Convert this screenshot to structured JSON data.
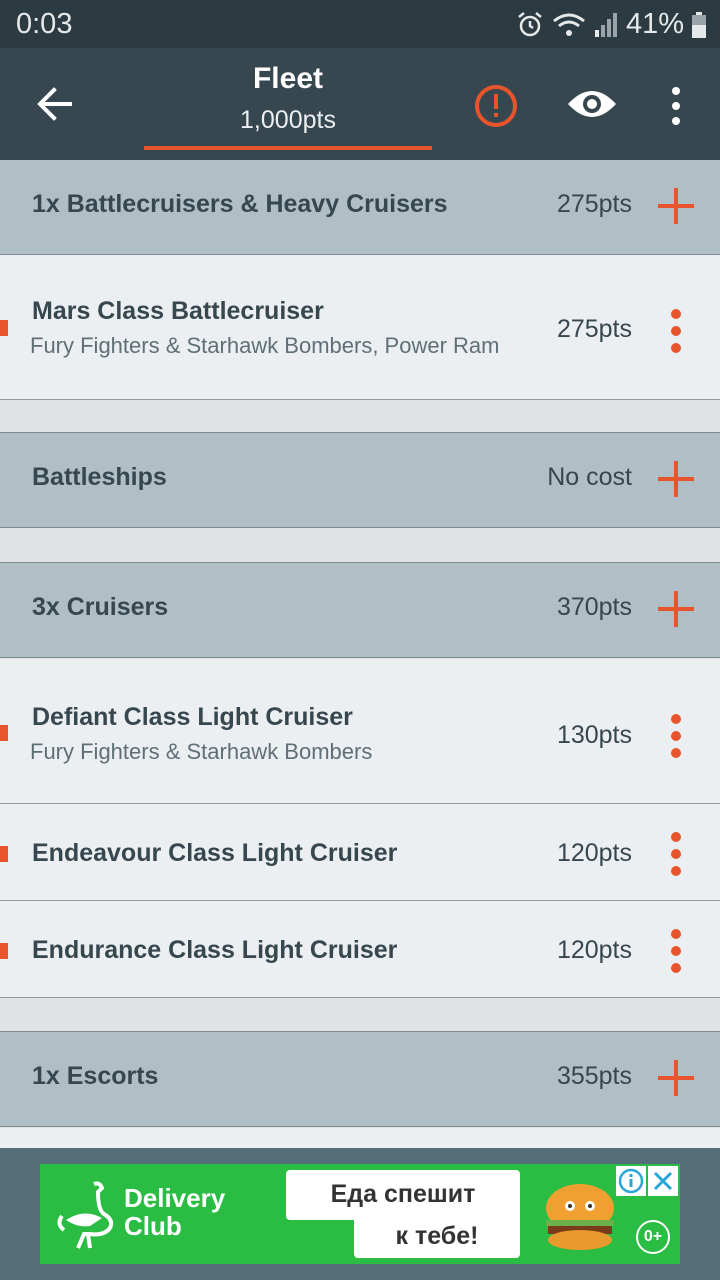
{
  "status_bar": {
    "time": "0:03",
    "battery": "41%"
  },
  "toolbar": {
    "title": "Fleet",
    "points": "1,000pts"
  },
  "groups": [
    {
      "label": "1x Battlecruisers & Heavy Cruisers",
      "cost": "275pts",
      "units": [
        {
          "name": "Mars Class Battlecruiser",
          "subtitle": "Fury Fighters & Starhawk Bombers, Power Ram",
          "cost": "275pts"
        }
      ]
    },
    {
      "label": "Battleships",
      "cost": "No cost",
      "units": []
    },
    {
      "label": "3x Cruisers",
      "cost": "370pts",
      "units": [
        {
          "name": "Defiant Class Light Cruiser",
          "subtitle": "Fury Fighters & Starhawk Bombers",
          "cost": "130pts"
        },
        {
          "name": "Endeavour Class Light Cruiser",
          "cost": "120pts"
        },
        {
          "name": "Endurance Class Light Cruiser",
          "cost": "120pts"
        }
      ]
    },
    {
      "label": "1x Escorts",
      "cost": "355pts",
      "units": []
    }
  ],
  "ad": {
    "brand_line1": "Delivery",
    "brand_line2": "Club",
    "slogan_line1": "Еда спешит",
    "slogan_line2": "к тебе!",
    "age_rating": "0+"
  },
  "colors": {
    "accent": "#e8542b",
    "toolbar": "#37474f",
    "status": "#2c3a41",
    "group": "#b0bec5",
    "row": "#eceff1",
    "ad": "#2bbc44"
  }
}
